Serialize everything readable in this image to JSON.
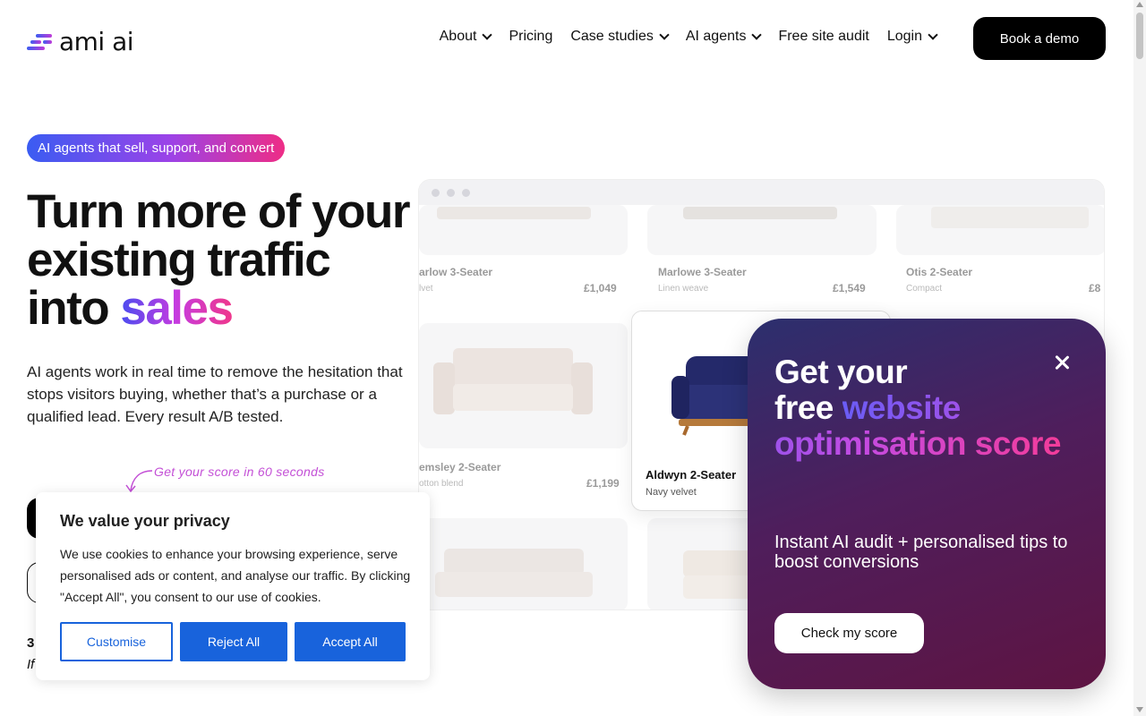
{
  "header": {
    "logo_text": "ami ai",
    "nav": [
      {
        "label": "About",
        "has_dropdown": true
      },
      {
        "label": "Pricing",
        "has_dropdown": false
      },
      {
        "label": "Case studies",
        "has_dropdown": true
      },
      {
        "label": "AI agents",
        "has_dropdown": true
      },
      {
        "label": "Free site audit",
        "has_dropdown": false
      },
      {
        "label": "Login",
        "has_dropdown": true
      }
    ],
    "cta": "Book a demo"
  },
  "hero": {
    "badge": "AI agents that sell, support, and convert",
    "headline_main": "Turn more of your existing traffic into ",
    "headline_accent": "sales",
    "subtext": "AI agents work in real time to remove the hesitation that stops visitors buying, whether that’s a purchase or a qualified lead. Every result A/B tested.",
    "score_note": "Get your score in 60 seconds",
    "stat_fragment_1": "3",
    "stat_fragment_2": "If"
  },
  "mockup": {
    "products": [
      {
        "name": "arlow 3-Seater",
        "desc": "lvet",
        "price": "£1,049"
      },
      {
        "name": "Marlowe 3-Seater",
        "desc": "Linen weave",
        "price": "£1,549"
      },
      {
        "name": "Otis 2-Seater",
        "desc": "Compact",
        "price": "£8"
      },
      {
        "name": "emsley 2-Seater",
        "desc": "otton blend",
        "price": "£1,199"
      }
    ],
    "featured": {
      "name": "Aldwyn 2-Seater",
      "desc": "Navy velvet"
    }
  },
  "popup": {
    "title_line1": "Get your",
    "title_line2_plain": "free ",
    "title_accent": "website optimisation score",
    "subtitle": "Instant AI audit + personalised tips to boost conversions",
    "button": "Check my score"
  },
  "cookie": {
    "title": "We value your privacy",
    "text": "We use cookies to enhance your browsing experience, serve personalised ads or content, and analyse our traffic. By clicking \"Accept All\", you consent to our use of cookies.",
    "customise": "Customise",
    "reject": "Reject All",
    "accept": "Accept All"
  }
}
